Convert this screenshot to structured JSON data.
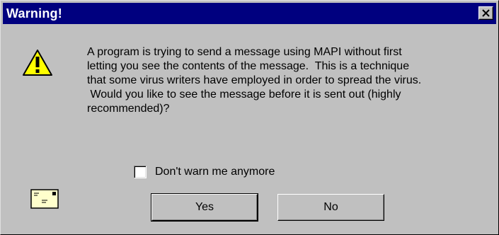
{
  "window": {
    "title": "Warning!",
    "close_glyph": "×"
  },
  "message": {
    "lines": [
      "A program is trying to send a message using MAPI without first",
      "letting you see the contents of the message.  This is a technique",
      "that some virus writers have employed in order to spread the virus.",
      " Would you like to see the message before it is sent out (highly",
      "recommended)?"
    ]
  },
  "checkbox": {
    "label": "Don't warn me anymore",
    "checked": false
  },
  "buttons": {
    "yes_label": "Yes",
    "no_label": "No"
  },
  "icons": {
    "warning": "warning-triangle-icon",
    "envelope": "envelope-icon",
    "close": "close-icon"
  },
  "colors": {
    "titlebar": "#00007f",
    "dialog_face": "#c0c0c0",
    "warning_yellow": "#ffff00"
  }
}
